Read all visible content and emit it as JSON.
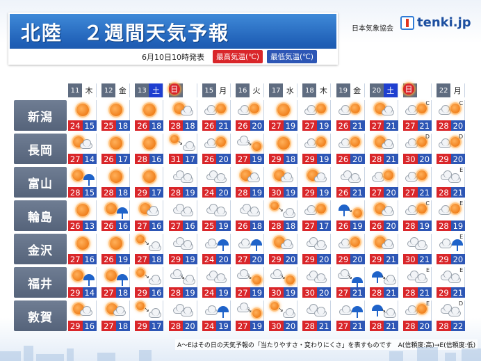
{
  "header": {
    "title": "北陸　２週間天気予報",
    "issued": "6月10日10時発表",
    "legend_max": "最高気温(℃)",
    "legend_min": "最低気温(℃)",
    "association": "日本気象協会",
    "brand": "tenki.jp"
  },
  "dates": [
    {
      "num": "11",
      "dow": "木",
      "type": "weekday"
    },
    {
      "num": "12",
      "dow": "金",
      "type": "weekday"
    },
    {
      "num": "13",
      "dow": "土",
      "type": "sat"
    },
    {
      "num": "14",
      "dow": "日",
      "type": "sun"
    },
    {
      "num": "15",
      "dow": "月",
      "type": "weekday"
    },
    {
      "num": "16",
      "dow": "火",
      "type": "weekday"
    },
    {
      "num": "17",
      "dow": "水",
      "type": "weekday"
    },
    {
      "num": "18",
      "dow": "木",
      "type": "weekday"
    },
    {
      "num": "19",
      "dow": "金",
      "type": "weekday"
    },
    {
      "num": "20",
      "dow": "土",
      "type": "sat"
    },
    {
      "num": "21",
      "dow": "日",
      "type": "sun"
    },
    {
      "num": "22",
      "dow": "月",
      "type": "weekday"
    }
  ],
  "cities": [
    {
      "name": "新潟",
      "days": [
        {
          "icon": "sunny",
          "max": "24",
          "min": "15",
          "conf": ""
        },
        {
          "icon": "sunny",
          "max": "25",
          "min": "18",
          "conf": ""
        },
        {
          "icon": "sunny",
          "max": "26",
          "min": "18",
          "conf": ""
        },
        {
          "icon": "sunny-cloudy",
          "max": "28",
          "min": "18",
          "conf": ""
        },
        {
          "icon": "cloudy-sunny",
          "max": "26",
          "min": "21",
          "conf": ""
        },
        {
          "icon": "cloudy-sunny",
          "max": "26",
          "min": "20",
          "conf": ""
        },
        {
          "icon": "sunny",
          "max": "27",
          "min": "19",
          "conf": ""
        },
        {
          "icon": "cloudy-sunny",
          "max": "27",
          "min": "19",
          "conf": ""
        },
        {
          "icon": "cloudy-sunny",
          "max": "26",
          "min": "21",
          "conf": ""
        },
        {
          "icon": "sunny-cloudy",
          "max": "27",
          "min": "21",
          "conf": ""
        },
        {
          "icon": "cloudy-sunny",
          "max": "27",
          "min": "21",
          "conf": "C"
        },
        {
          "icon": "cloudy-sunny",
          "max": "28",
          "min": "20",
          "conf": "C"
        }
      ]
    },
    {
      "name": "長岡",
      "days": [
        {
          "icon": "sunny-cloudy",
          "max": "27",
          "min": "14",
          "conf": ""
        },
        {
          "icon": "sunny",
          "max": "26",
          "min": "17",
          "conf": ""
        },
        {
          "icon": "sunny",
          "max": "28",
          "min": "16",
          "conf": ""
        },
        {
          "icon": "sunny-then-cloudy",
          "max": "31",
          "min": "17",
          "conf": ""
        },
        {
          "icon": "cloudy-sunny",
          "max": "26",
          "min": "20",
          "conf": ""
        },
        {
          "icon": "cloudy-then-sunny",
          "max": "27",
          "min": "19",
          "conf": ""
        },
        {
          "icon": "sunny",
          "max": "29",
          "min": "18",
          "conf": ""
        },
        {
          "icon": "cloudy-sunny",
          "max": "29",
          "min": "19",
          "conf": ""
        },
        {
          "icon": "cloudy-sunny",
          "max": "26",
          "min": "20",
          "conf": ""
        },
        {
          "icon": "sunny-cloudy",
          "max": "28",
          "min": "21",
          "conf": ""
        },
        {
          "icon": "cloudy-sunny",
          "max": "30",
          "min": "20",
          "conf": "D"
        },
        {
          "icon": "cloudy-sunny",
          "max": "29",
          "min": "20",
          "conf": "D"
        }
      ]
    },
    {
      "name": "富山",
      "days": [
        {
          "icon": "sunny-rain",
          "max": "28",
          "min": "15",
          "conf": ""
        },
        {
          "icon": "sunny",
          "max": "28",
          "min": "18",
          "conf": ""
        },
        {
          "icon": "sunny",
          "max": "29",
          "min": "17",
          "conf": ""
        },
        {
          "icon": "cloudy",
          "max": "28",
          "min": "19",
          "conf": ""
        },
        {
          "icon": "cloudy",
          "max": "24",
          "min": "20",
          "conf": ""
        },
        {
          "icon": "sunny-cloudy",
          "max": "28",
          "min": "19",
          "conf": ""
        },
        {
          "icon": "sunny-cloudy",
          "max": "30",
          "min": "19",
          "conf": ""
        },
        {
          "icon": "sunny-cloudy",
          "max": "29",
          "min": "19",
          "conf": ""
        },
        {
          "icon": "cloudy",
          "max": "26",
          "min": "21",
          "conf": ""
        },
        {
          "icon": "cloudy-sunny",
          "max": "27",
          "min": "20",
          "conf": ""
        },
        {
          "icon": "cloudy-sunny",
          "max": "27",
          "min": "21",
          "conf": ""
        },
        {
          "icon": "cloudy",
          "max": "28",
          "min": "21",
          "conf": "E"
        }
      ]
    },
    {
      "name": "輪島",
      "days": [
        {
          "icon": "sunny",
          "max": "26",
          "min": "13",
          "conf": ""
        },
        {
          "icon": "sunny-rain",
          "max": "26",
          "min": "16",
          "conf": ""
        },
        {
          "icon": "sunny-cloudy",
          "max": "27",
          "min": "16",
          "conf": ""
        },
        {
          "icon": "cloudy",
          "max": "27",
          "min": "16",
          "conf": ""
        },
        {
          "icon": "cloudy",
          "max": "25",
          "min": "19",
          "conf": ""
        },
        {
          "icon": "cloudy",
          "max": "26",
          "min": "18",
          "conf": ""
        },
        {
          "icon": "sunny-then-cloudy",
          "max": "28",
          "min": "18",
          "conf": ""
        },
        {
          "icon": "cloudy-sunny",
          "max": "27",
          "min": "17",
          "conf": ""
        },
        {
          "icon": "rain-then-sunny",
          "max": "26",
          "min": "19",
          "conf": ""
        },
        {
          "icon": "sunny-cloudy",
          "max": "26",
          "min": "20",
          "conf": ""
        },
        {
          "icon": "cloudy-sunny",
          "max": "28",
          "min": "19",
          "conf": "C"
        },
        {
          "icon": "cloudy-sunny",
          "max": "28",
          "min": "19",
          "conf": "E"
        }
      ]
    },
    {
      "name": "金沢",
      "days": [
        {
          "icon": "sunny",
          "max": "27",
          "min": "16",
          "conf": ""
        },
        {
          "icon": "sunny",
          "max": "26",
          "min": "19",
          "conf": ""
        },
        {
          "icon": "sunny-then-cloudy",
          "max": "27",
          "min": "18",
          "conf": ""
        },
        {
          "icon": "cloudy",
          "max": "29",
          "min": "19",
          "conf": ""
        },
        {
          "icon": "cloudy-rain",
          "max": "24",
          "min": "20",
          "conf": ""
        },
        {
          "icon": "cloudy-rain",
          "max": "27",
          "min": "20",
          "conf": ""
        },
        {
          "icon": "sunny-cloudy",
          "max": "29",
          "min": "20",
          "conf": ""
        },
        {
          "icon": "cloudy",
          "max": "29",
          "min": "20",
          "conf": ""
        },
        {
          "icon": "cloudy-sunny",
          "max": "29",
          "min": "20",
          "conf": ""
        },
        {
          "icon": "sunny-cloudy",
          "max": "29",
          "min": "21",
          "conf": ""
        },
        {
          "icon": "cloudy",
          "max": "30",
          "min": "21",
          "conf": ""
        },
        {
          "icon": "cloudy-rain",
          "max": "29",
          "min": "20",
          "conf": "E"
        }
      ]
    },
    {
      "name": "福井",
      "days": [
        {
          "icon": "sunny-rain",
          "max": "29",
          "min": "14",
          "conf": ""
        },
        {
          "icon": "sunny-rain",
          "max": "27",
          "min": "18",
          "conf": ""
        },
        {
          "icon": "sunny-then-cloudy",
          "max": "29",
          "min": "16",
          "conf": ""
        },
        {
          "icon": "cloudy-then-cloudy",
          "max": "28",
          "min": "19",
          "conf": ""
        },
        {
          "icon": "cloudy",
          "max": "24",
          "min": "19",
          "conf": ""
        },
        {
          "icon": "cloudy-then-sunny",
          "max": "27",
          "min": "19",
          "conf": ""
        },
        {
          "icon": "cloudy-then-sunny",
          "max": "30",
          "min": "19",
          "conf": ""
        },
        {
          "icon": "cloudy",
          "max": "30",
          "min": "20",
          "conf": ""
        },
        {
          "icon": "cloudy-then-rain",
          "max": "27",
          "min": "21",
          "conf": ""
        },
        {
          "icon": "rain-then-cloudy",
          "max": "28",
          "min": "21",
          "conf": ""
        },
        {
          "icon": "cloudy",
          "max": "28",
          "min": "21",
          "conf": "E"
        },
        {
          "icon": "cloudy",
          "max": "29",
          "min": "21",
          "conf": "E"
        }
      ]
    },
    {
      "name": "敦賀",
      "days": [
        {
          "icon": "sunny-cloudy",
          "max": "29",
          "min": "16",
          "conf": ""
        },
        {
          "icon": "sunny-cloudy",
          "max": "27",
          "min": "18",
          "conf": ""
        },
        {
          "icon": "sunny-then-cloudy",
          "max": "29",
          "min": "17",
          "conf": ""
        },
        {
          "icon": "cloudy",
          "max": "28",
          "min": "20",
          "conf": ""
        },
        {
          "icon": "cloudy-rain",
          "max": "24",
          "min": "19",
          "conf": ""
        },
        {
          "icon": "cloudy-then-sunny",
          "max": "27",
          "min": "19",
          "conf": ""
        },
        {
          "icon": "sunny-then-cloudy",
          "max": "30",
          "min": "20",
          "conf": ""
        },
        {
          "icon": "cloudy",
          "max": "28",
          "min": "21",
          "conf": ""
        },
        {
          "icon": "cloudy-rain",
          "max": "27",
          "min": "21",
          "conf": ""
        },
        {
          "icon": "rain-then-cloudy",
          "max": "28",
          "min": "21",
          "conf": ""
        },
        {
          "icon": "cloudy-sunny",
          "max": "28",
          "min": "20",
          "conf": "E"
        },
        {
          "icon": "cloudy",
          "max": "28",
          "min": "22",
          "conf": "D"
        }
      ]
    }
  ],
  "footer": {
    "note": "A～Eはその日の天気予報の「当たりやすさ・変わりにくさ」を表すものです　A(信頼度:高)→E(信頼度:低)"
  },
  "colors": {
    "max_temp": "#d9262a",
    "min_temp": "#2d56b5",
    "title_bg": "#2a6fc6",
    "city_label_bg": "#5f6c80"
  }
}
